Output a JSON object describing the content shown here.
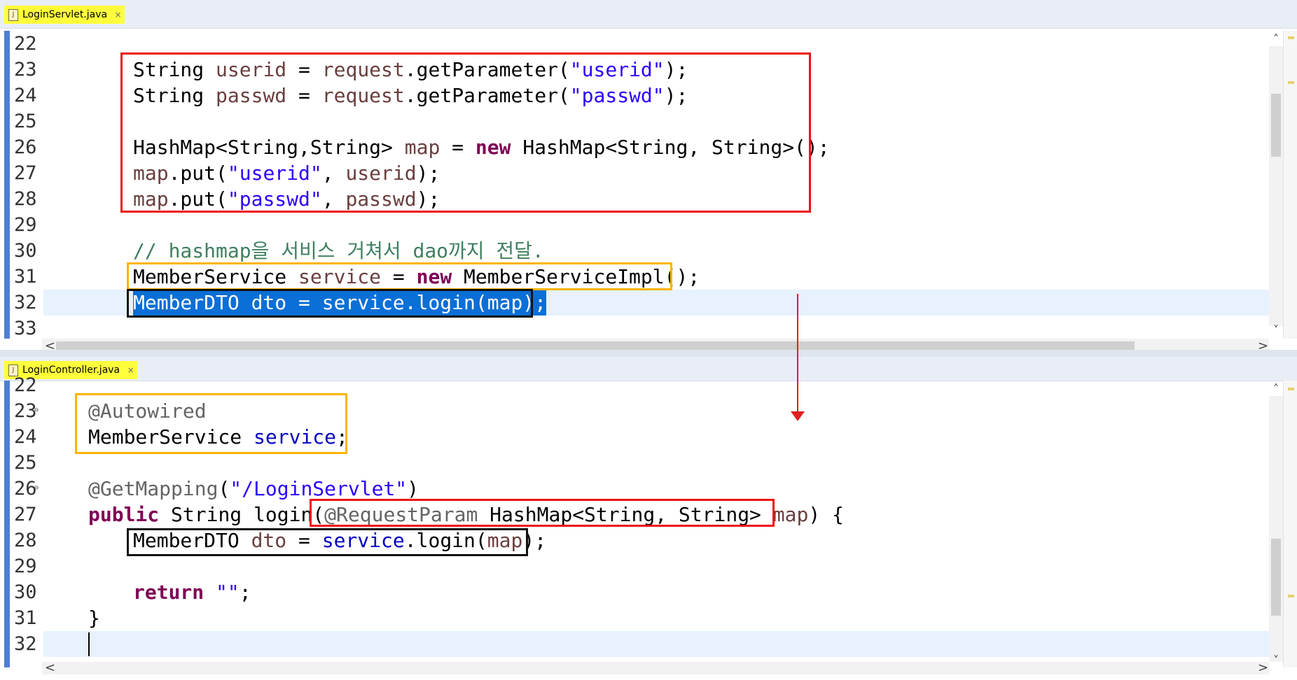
{
  "top_editor": {
    "tab_label": "LoginServlet.java",
    "close_glyph": "×",
    "file_icon": "java-file-icon",
    "line_numbers": [
      "22",
      "23",
      "24",
      "25",
      "26",
      "27",
      "28",
      "29",
      "30",
      "31",
      "32",
      "33"
    ],
    "code": {
      "l23": {
        "t1": "String ",
        "v1": "userid",
        "t2": " = ",
        "v2": "request",
        "t3": ".getParameter(",
        "s1": "\"userid\"",
        "t4": ");"
      },
      "l24": {
        "t1": "String ",
        "v1": "passwd",
        "t2": " = ",
        "v2": "request",
        "t3": ".getParameter(",
        "s1": "\"passwd\"",
        "t4": ");"
      },
      "l26": {
        "t1": "HashMap<String,String> ",
        "v1": "map",
        "t2": " = ",
        "k1": "new",
        "t3": " HashMap<String, String>();"
      },
      "l27": {
        "v1": "map",
        "t1": ".put(",
        "s1": "\"userid\"",
        "t2": ", ",
        "v2": "userid",
        "t3": ");"
      },
      "l28": {
        "v1": "map",
        "t1": ".put(",
        "s1": "\"passwd\"",
        "t2": ", ",
        "v2": "passwd",
        "t3": ");"
      },
      "l30": {
        "c1": "// hashmap을 서비스 거쳐서 dao까지 전달."
      },
      "l31": {
        "t1": "MemberService ",
        "v1": "service",
        "t2": " = ",
        "k1": "new",
        "t3": " MemberServiceImpl();"
      },
      "l32": {
        "sel": "MemberDTO dto = service.login(map);"
      }
    }
  },
  "bottom_editor": {
    "tab_label": "LoginController.java",
    "close_glyph": "×",
    "file_icon": "java-file-icon",
    "line_numbers": [
      "22",
      "23",
      "24",
      "25",
      "26",
      "27",
      "28",
      "29",
      "30",
      "31",
      "32"
    ],
    "fold_glyph": "⊖",
    "code": {
      "l23": {
        "a1": "@Autowired"
      },
      "l24": {
        "t1": "MemberService ",
        "f1": "service",
        "t2": ";"
      },
      "l26": {
        "a1": "@GetMapping",
        "t1": "(",
        "s1": "\"/LoginServlet\"",
        "t2": ")"
      },
      "l27": {
        "k1": "public",
        "t1": " String login(",
        "a1": "@RequestParam",
        "t2": " HashMap<String, String> ",
        "v1": "map",
        "t3": ") {"
      },
      "l28": {
        "t1": "MemberDTO ",
        "v1": "dto",
        "t2": " = ",
        "f1": "service",
        "t3": ".login(",
        "v2": "map",
        "t4": ");"
      },
      "l30": {
        "k1": "return",
        "t1": " ",
        "s1": "\"\"",
        "t2": ";"
      },
      "l31": {
        "t1": "}"
      }
    }
  },
  "scroll": {
    "up": "˄",
    "down": "˅",
    "left": "<",
    "right": ">"
  },
  "colors": {
    "red_box": "#ee1111",
    "orange_box": "#ffb400",
    "black_box": "#111111",
    "selection": "#0a6fd6",
    "arrow": "#e02020"
  }
}
